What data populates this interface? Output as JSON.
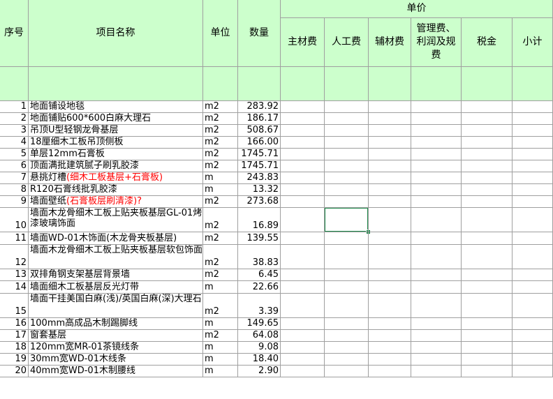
{
  "header": {
    "seq": "序号",
    "name": "项目名称",
    "unit": "单位",
    "qty": "数量",
    "price_group": "单价",
    "main_material": "主材费",
    "labor": "人工费",
    "aux_material": "辅材费",
    "management": "管理费、利润及规费",
    "tax": "税金",
    "subtotal": "小计"
  },
  "rows": [
    {
      "seq": "1",
      "name": "地面铺设地毯",
      "unit": "m2",
      "qty": "283.92"
    },
    {
      "seq": "2",
      "name": "地面铺贴600*600白麻大理石",
      "unit": "m2",
      "qty": "186.17"
    },
    {
      "seq": "3",
      "name": "吊顶U型轻钢龙骨基层",
      "unit": "m2",
      "qty": "508.67"
    },
    {
      "seq": "4",
      "name": "18厘细木工板吊顶侧板",
      "unit": "m2",
      "qty": "166.00"
    },
    {
      "seq": "5",
      "name": "单层12mm石膏板",
      "unit": "m2",
      "qty": "1745.71"
    },
    {
      "seq": "6",
      "name": "顶面满批建筑腻子刷乳胶漆",
      "unit": "m2",
      "qty": "1745.71"
    },
    {
      "seq": "7",
      "name": "悬挑灯槽",
      "name_red": "(细木工板基层+石膏板)",
      "unit": "m",
      "qty": "243.83"
    },
    {
      "seq": "8",
      "name": "R120石膏线批乳胶漆",
      "unit": "m",
      "qty": "13.32"
    },
    {
      "seq": "9",
      "name": "墙面壁纸",
      "name_red": "(石膏板层刷清漆)?",
      "unit": "m2",
      "qty": "273.68"
    },
    {
      "seq": "10",
      "name": "墙面木龙骨细木工板上贴夹板基层GL-01烤漆玻璃饰面",
      "unit": "m2",
      "qty": "16.89"
    },
    {
      "seq": "11",
      "name": "墙面WD-01木饰面(木龙骨夹板基层)",
      "unit": "m2",
      "qty": "139.55"
    },
    {
      "seq": "12",
      "name": "墙面木龙骨细木工板上贴夹板基层软包饰面",
      "unit": "m2",
      "qty": "38.83"
    },
    {
      "seq": "13",
      "name": "双排角钢支架基层背景墙",
      "unit": "m2",
      "qty": "6.45"
    },
    {
      "seq": "14",
      "name": "墙面细木工板基层反光灯带",
      "unit": "m",
      "qty": "22.66"
    },
    {
      "seq": "15",
      "name": "墙面干挂美国白麻(浅)/英国白麻(深)大理石",
      "unit": "m2",
      "qty": "3.39"
    },
    {
      "seq": "16",
      "name": "100mm高成品木制踢脚线",
      "unit": "m",
      "qty": "149.65"
    },
    {
      "seq": "17",
      "name": "窗套基层",
      "unit": "m2",
      "qty": "64.08"
    },
    {
      "seq": "18",
      "name": "120mm宽MR-01茶镜线条",
      "unit": "m",
      "qty": "9.08"
    },
    {
      "seq": "19",
      "name": "30mm宽WD-01木线条",
      "unit": "m",
      "qty": "18.40"
    },
    {
      "seq": "20",
      "name": "40mm宽WD-01木制腰线",
      "unit": "m",
      "qty": "2.90"
    }
  ],
  "colors": {
    "header_fill": "#ccffcc",
    "grid": "#9f9f9f",
    "red_text": "#ff0000",
    "selection": "#1f8a4c"
  }
}
